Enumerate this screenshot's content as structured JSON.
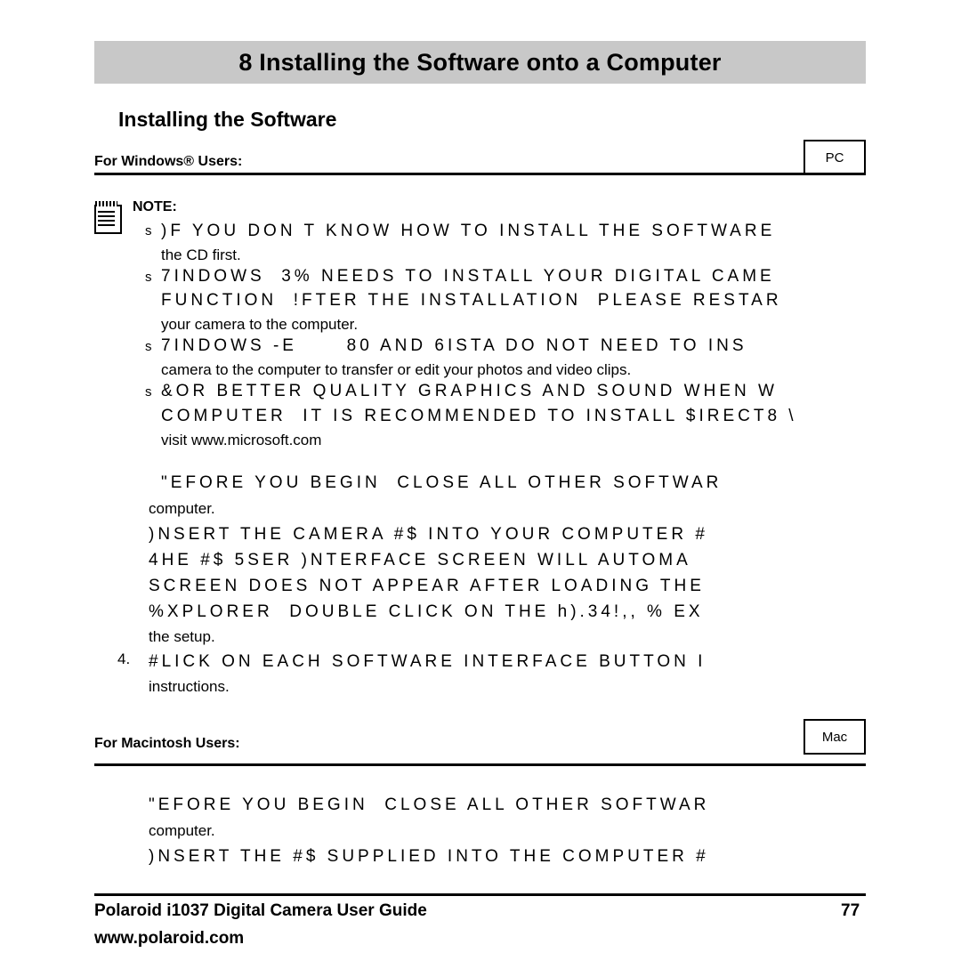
{
  "chapter": {
    "title": "8 Installing the Software onto a Computer"
  },
  "section": {
    "heading": "Installing the Software"
  },
  "windows": {
    "sub_heading": "For Windows® Users:",
    "badge": "PC",
    "note_label": "NOTE:",
    "bullet_mark": "s",
    "notes": [
      {
        "line1": ")F YOU DON T KNOW HOW TO INSTALL THE SOFTWARE",
        "line2": "the CD first."
      },
      {
        "line1": "7INDOWS  3% NEEDS TO INSTALL YOUR DIGITAL CAME",
        "line2": "FUNCTION  !FTER THE INSTALLATION  PLEASE RESTAR",
        "line3": "your camera to the computer."
      },
      {
        "line1": "7INDOWS -E      80 AND 6ISTA DO NOT NEED TO INS",
        "line2": "camera to the computer to transfer or edit your photos and video clips."
      },
      {
        "line1": "&OR BETTER QUALITY GRAPHICS AND SOUND WHEN W",
        "line2": "COMPUTER  IT IS RECOMMENDED TO INSTALL $IRECT8 \\",
        "line3": "visit www.microsoft.com"
      }
    ],
    "steps": [
      {
        "number": "",
        "line1": "\"EFORE YOU BEGIN  CLOSE ALL OTHER SOFTWAR",
        "line2": "computer."
      },
      {
        "number": "",
        "line1": ")NSERT THE CAMERA #$ INTO YOUR COMPUTER #",
        "line2": "4HE #$ 5SER )NTERFACE SCREEN WILL AUTOMA",
        "line3": "SCREEN DOES NOT APPEAR AFTER LOADING THE",
        "line4": "%XPLORER  DOUBLE CLICK ON THE h).34!,, % EX",
        "line5": "the setup."
      },
      {
        "number": "4.",
        "line1": "#LICK ON EACH SOFTWARE INTERFACE BUTTON I",
        "line2": "instructions."
      }
    ]
  },
  "macintosh": {
    "sub_heading": "For Macintosh Users:",
    "badge": "Mac",
    "steps": [
      {
        "line1": "\"EFORE YOU BEGIN  CLOSE ALL OTHER SOFTWAR",
        "line2": "computer."
      },
      {
        "line1": ")NSERT THE #$ SUPPLIED INTO THE COMPUTER #"
      }
    ]
  },
  "footer": {
    "title": "Polaroid i1037 Digital Camera User Guide",
    "url": "www.polaroid.com",
    "page_number": "77"
  },
  "colors": {
    "chapter_bar_bg": "#c8c8c8",
    "text": "#000000",
    "page_bg": "#ffffff"
  }
}
